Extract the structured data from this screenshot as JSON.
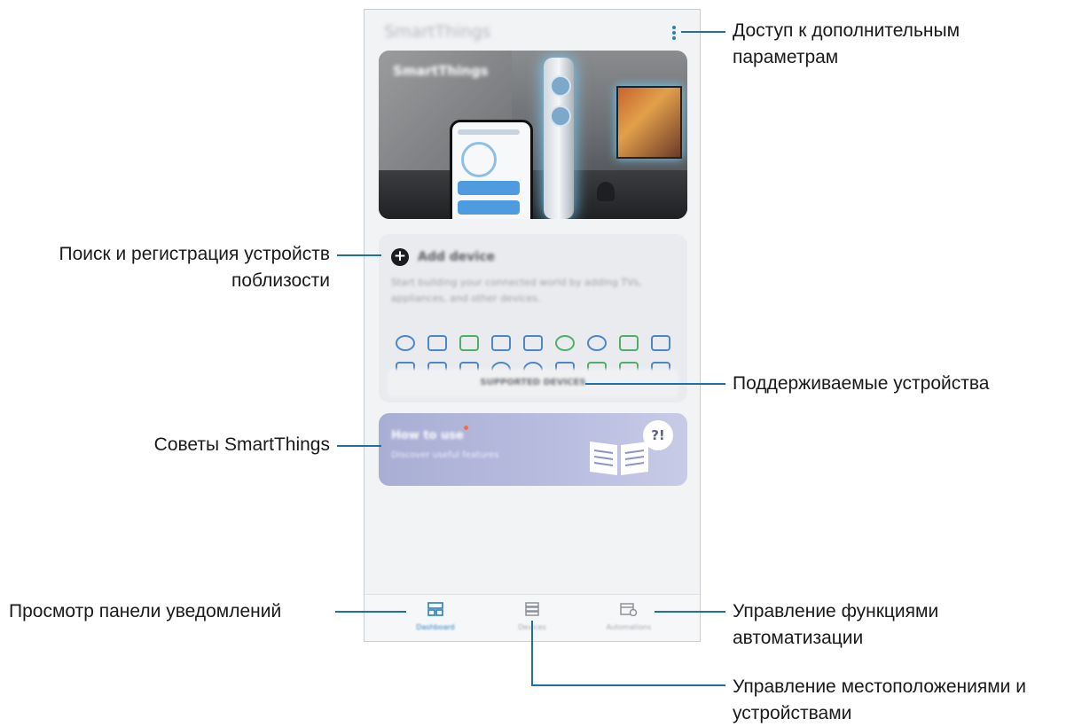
{
  "app": {
    "title": "SmartThings"
  },
  "hero": {
    "title": "SmartThings",
    "subtitle": ""
  },
  "add_device": {
    "title": "Add device",
    "description": "Start building your connected world by adding TVs, appliances, and other devices.",
    "supported_button": "SUPPORTED DEVICES"
  },
  "howto": {
    "title": "How to use",
    "subtitle": "Discover useful features",
    "badge": "?!"
  },
  "nav": {
    "items": [
      {
        "label": "Dashboard",
        "icon": "dashboard-icon"
      },
      {
        "label": "Devices",
        "icon": "devices-icon"
      },
      {
        "label": "Automations",
        "icon": "automations-icon"
      }
    ]
  },
  "annotations": {
    "more_options": "Доступ к дополнительным параметрам",
    "add_device": "Поиск и регистрация устройств поблизости",
    "supported": "Поддерживаемые устройства",
    "tips": "Советы SmartThings",
    "dashboard": "Просмотр панели уведомлений",
    "automations": "Управление функциями автоматизации",
    "devices": "Управление местоположениями и устройствами"
  },
  "colors": {
    "accent": "#2a7fc1",
    "line": "#1f6fa8"
  }
}
